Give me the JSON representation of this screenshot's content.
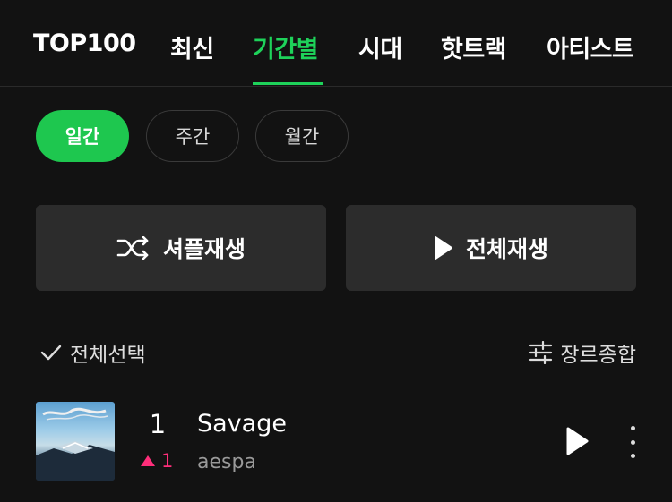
{
  "tabs": [
    {
      "label": "TOP100",
      "active": false
    },
    {
      "label": "최신",
      "active": false
    },
    {
      "label": "기간별",
      "active": true
    },
    {
      "label": "시대",
      "active": false
    },
    {
      "label": "핫트랙",
      "active": false
    },
    {
      "label": "아티스트",
      "active": false
    }
  ],
  "period_filters": [
    {
      "label": "일간",
      "active": true
    },
    {
      "label": "주간",
      "active": false
    },
    {
      "label": "월간",
      "active": false
    }
  ],
  "actions": {
    "shuffle_label": "셔플재생",
    "play_all_label": "전체재생"
  },
  "toolbar": {
    "select_all_label": "전체선택",
    "genre_label": "장르종합"
  },
  "tracks": [
    {
      "rank": "1",
      "change": "1",
      "change_direction": "up",
      "title": "Savage",
      "artist": "aespa"
    }
  ],
  "colors": {
    "accent": "#1ed25a",
    "rank_up": "#ff2e7a",
    "background": "#121212",
    "button_bg": "#2c2c2c"
  }
}
